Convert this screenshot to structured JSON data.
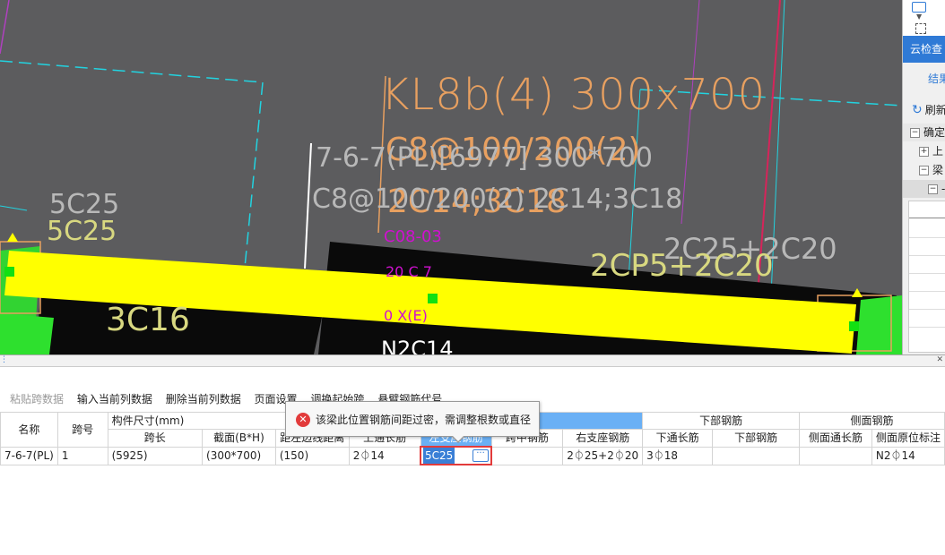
{
  "cad": {
    "beam_title": "KL8b(4) 300x700",
    "beam_stirrup": "C8@100/200(2)",
    "beam_bars": "2C14;3C18",
    "span_label": "7-6-7(PL)[6977] 300*700",
    "span_rebar": "C8@100/200(2) 2C14;3C18",
    "left_top": "5C25",
    "left_top2": "5C25",
    "bottom_left": "3C16",
    "right_support": "2C25+2C20",
    "right_support2": "2CP5+2C20",
    "magenta1": "C08-03",
    "magenta2": "20 C 7",
    "magenta3": "0 X(E)",
    "side_bar": "N2C14"
  },
  "right_panel": {
    "title": "云检查",
    "result_label": "结果",
    "refresh_label": "刷新",
    "tree": [
      "确定",
      "上",
      "梁",
      "-"
    ]
  },
  "toolbar": {
    "paste": "粘贴跨数据",
    "input": "输入当前列数据",
    "delete": "删除当前列数据",
    "page_setup": "页面设置",
    "swap": "调换起始跨",
    "cantilever": "悬臂钢筋代号"
  },
  "table": {
    "headers_top": {
      "name": "名称",
      "span": "跨号",
      "size": "构件尺寸(mm)",
      "top_rebar": "上部钢筋",
      "bottom_rebar": "下部钢筋",
      "side_rebar": "侧面钢筋"
    },
    "headers_sub": {
      "span_len": "跨长",
      "section": "截面(B*H)",
      "dist": "距左边线距离",
      "through": "上通长筋",
      "left_seat": "左支座钢筋",
      "mid_span": "跨中钢筋",
      "right_seat": "右支座钢筋",
      "bot_through": "下通长筋",
      "bot_rebar": "下部钢筋",
      "side_through": "侧面通长筋",
      "side_orig": "侧面原位标注"
    },
    "row": {
      "name": "7-6-7(PL)",
      "span": "1",
      "span_len": "(5925)",
      "section": "(300*700)",
      "dist": "(150)",
      "through": "2⏀14",
      "left_seat": "5C25",
      "mid_span": "",
      "right_seat": "2⏀25+2⏀20",
      "bot_through": "3⏀18",
      "bot_rebar": "",
      "side_through": "",
      "side_orig": "N2⏀14"
    }
  },
  "tooltip": {
    "message": "该梁此位置钢筋间距过密，需调整根数或直径"
  },
  "colors": {
    "cad_bg": "#5c5c5e",
    "beam": "#ffff00",
    "accent_blue": "#2f7ad6",
    "error_red": "#e23b3b"
  }
}
